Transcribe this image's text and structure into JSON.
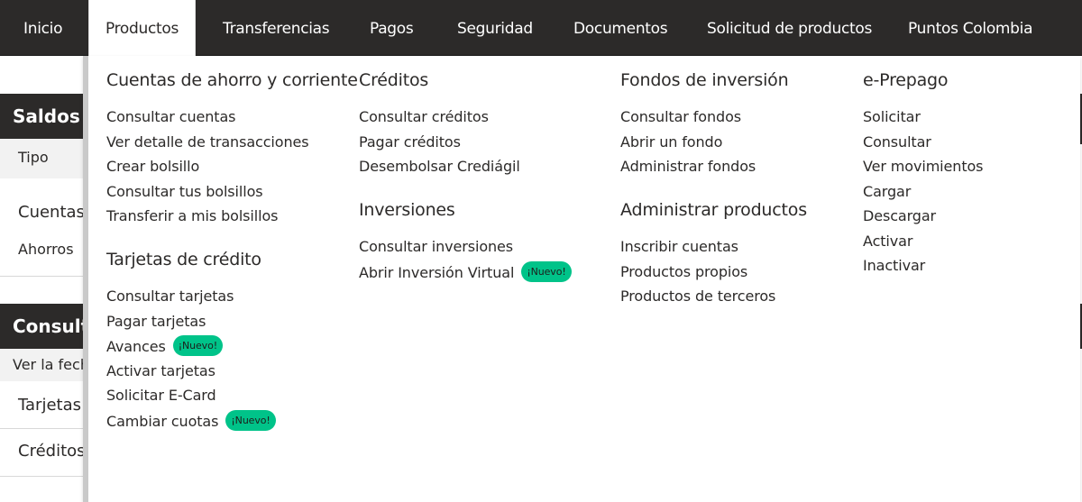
{
  "nav": {
    "items": [
      {
        "label": "Inicio",
        "active": false
      },
      {
        "label": "Productos",
        "active": true
      },
      {
        "label": "Transferencias",
        "active": false
      },
      {
        "label": "Pagos",
        "active": false
      },
      {
        "label": "Seguridad",
        "active": false
      },
      {
        "label": "Documentos",
        "active": false
      },
      {
        "label": "Solicitud de productos",
        "active": false
      },
      {
        "label": "Puntos Colombia",
        "active": false
      }
    ]
  },
  "background": {
    "saldos_title": "Saldos po",
    "tipo_label": "Tipo",
    "cuentas_label": "Cuentas",
    "ahorros_label": "Ahorros",
    "consulta_title": "Consulta",
    "ver_fecha_label": "Ver la fecha",
    "tarjetas_label": "Tarjetas",
    "creditos_label": "Créditos"
  },
  "menu": {
    "badge_label": "¡Nuevo!",
    "cuentas": {
      "heading": "Cuentas de ahorro y corriente",
      "links": [
        "Consultar cuentas",
        "Ver detalle de transacciones",
        "Crear bolsillo",
        "Consultar tus bolsillos",
        "Transferir a mis bolsillos"
      ]
    },
    "tarjetas": {
      "heading": "Tarjetas de crédito",
      "links": [
        "Consultar tarjetas",
        "Pagar tarjetas",
        "Avances",
        "Activar tarjetas",
        "Solicitar E-Card",
        "Cambiar cuotas"
      ]
    },
    "creditos": {
      "heading": "Créditos",
      "links": [
        "Consultar créditos",
        "Pagar créditos",
        "Desembolsar Crediágil"
      ]
    },
    "inversiones": {
      "heading": "Inversiones",
      "links": [
        "Consultar inversiones",
        "Abrir Inversión Virtual"
      ]
    },
    "fondos": {
      "heading": "Fondos de inversión",
      "links": [
        "Consultar fondos",
        "Abrir un fondo",
        "Administrar fondos"
      ]
    },
    "administrar": {
      "heading": "Administrar productos",
      "links": [
        "Inscribir cuentas",
        "Productos propios",
        "Productos de terceros"
      ]
    },
    "eprepago": {
      "heading": "e-Prepago",
      "links": [
        "Solicitar",
        "Consultar",
        "Ver movimientos",
        "Cargar",
        "Descargar",
        "Activar",
        "Inactivar"
      ]
    }
  }
}
